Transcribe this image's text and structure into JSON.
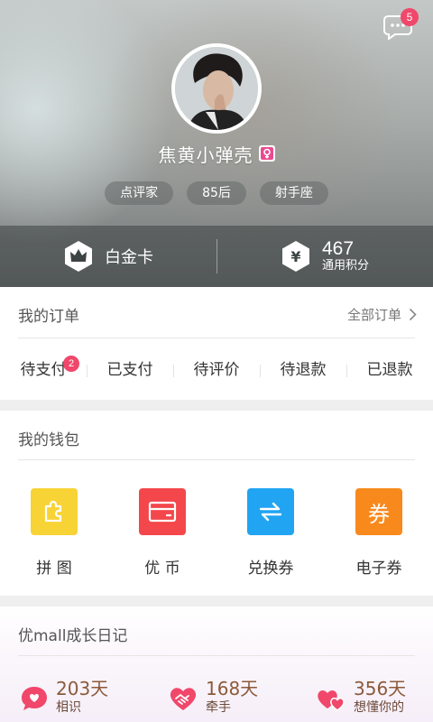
{
  "profile": {
    "username": "焦黄小弹壳",
    "gender_icon": "female-icon",
    "tags": [
      "点评家",
      "85后",
      "射手座"
    ],
    "message_badge": "5"
  },
  "membership": {
    "card_label": "白金卡",
    "points_value": "467",
    "points_label": "通用积分"
  },
  "orders": {
    "title": "我的订单",
    "all_orders_label": "全部订单",
    "tabs": [
      {
        "label": "待支付",
        "badge": "2"
      },
      {
        "label": "已支付"
      },
      {
        "label": "待评价"
      },
      {
        "label": "待退款"
      },
      {
        "label": "已退款"
      }
    ]
  },
  "wallet": {
    "title": "我的钱包",
    "items": [
      {
        "label": "拼 图",
        "icon": "puzzle-icon",
        "color": "#f7d336"
      },
      {
        "label": "优 币",
        "icon": "card-icon",
        "color": "#f3474b"
      },
      {
        "label": "兑换券",
        "icon": "exchange-icon",
        "color": "#21a4f2"
      },
      {
        "label": "电子券",
        "icon": "coupon-icon",
        "color": "#f8891c",
        "glyph": "券"
      }
    ]
  },
  "diary": {
    "title": "优mall成长日记",
    "stats": [
      {
        "value": "203天",
        "label": "相识",
        "icon": "chat-heart-icon"
      },
      {
        "value": "168天",
        "label": "牵手",
        "icon": "handshake-heart-icon"
      },
      {
        "value": "356天",
        "label": "想懂你的",
        "icon": "double-heart-icon"
      }
    ],
    "accent_color": "#f0476b"
  }
}
